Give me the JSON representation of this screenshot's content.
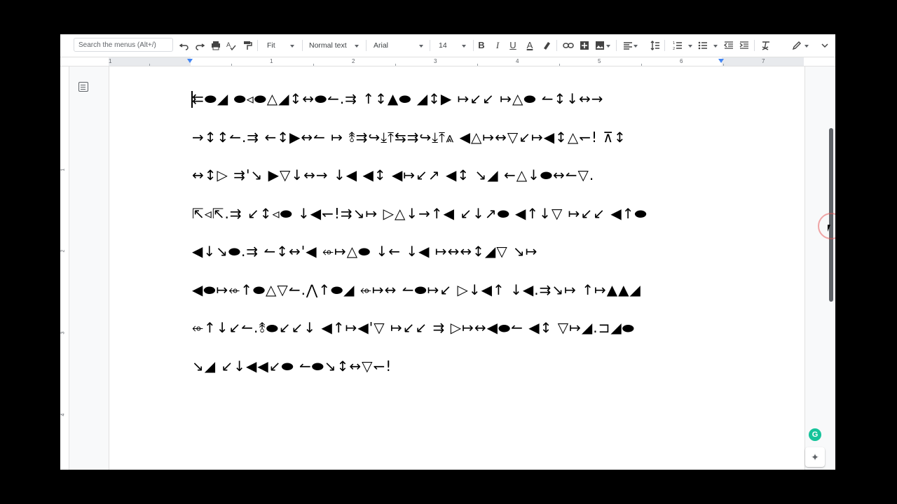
{
  "toolbar": {
    "search_placeholder": "Search the menus (Alt+/)",
    "undo_icon": "undo-icon",
    "redo_icon": "redo-icon",
    "print_icon": "print-icon",
    "spellcheck_icon": "spellcheck-icon",
    "paint_format_icon": "paint-format-icon",
    "zoom": "Fit",
    "style": "Normal text",
    "font": "Arial",
    "font_size": "14",
    "bold": "B",
    "italic": "I",
    "underline": "U",
    "text_color": "A",
    "accent_color": "#4285f4"
  },
  "ruler": {
    "numbers": [
      "1",
      "1",
      "2",
      "3",
      "4",
      "5",
      "6",
      "7"
    ]
  },
  "vertical_ruler": {
    "numbers": [
      "1",
      "2",
      "3",
      "4"
    ]
  },
  "document": {
    "lines": [
      "⇇⬬◢  ⬬◃⬬△◢↕↔⬬↼.⇉  ↑↕▲⬬  ◢↕▶  ↦↙↙  ↦△⬬  ↼↕↓↔→",
      "→↕↕↼.⇉  ←↕▶↔↼  ↦  ⥉⇉↪⤓⤒⇆⇉↪⤓⤒⩓  ◀△↦↔▽↙↦◀↕△↽! ⊼↕",
      "↔↕▷  ⇉'↘  ▶▽↓↔→  ↓◀  ◀↕  ◀↦↙↗  ◀↕  ↘◢  ←△↓⬬↔↼▽.",
      "⇱◃⇱.⇉  ↙↕◃⬬  ↓◀↽!⇉↘↦  ▷△↓→↑◀  ↙↓↗⬬  ◀↑↓▽  ↦↙↙  ◀↑⬬",
      "◀↓↘⬬.⇉  ↼↕↔'◀  ⬰↦△⬬  ↓←  ↓◀  ↦↔↔↕◢▽  ↘↦",
      "◀⬬↦⬰↑⬬△▽↼.⋀↑⬬◢  ⬰↦↔  ↼⬬↦↙  ▷↓◀↑  ↓◀.⇉↘↦  ↑↦▲▲◢",
      "⬰↑↓↙↼.⥉⬬↙↙↓  ◀↑↦◀'▽  ↦↙↙  ⇉  ▷↦↔◀⬬↼  ◀↕  ▽↦◢.⊐◢⬬",
      "↘◢  ↙↓◀◀↙⬬  ↼⬬↘↕↔▽↽!"
    ]
  },
  "sidebar": {
    "grammarly_label": "G",
    "explore_icon": "explore-icon"
  }
}
